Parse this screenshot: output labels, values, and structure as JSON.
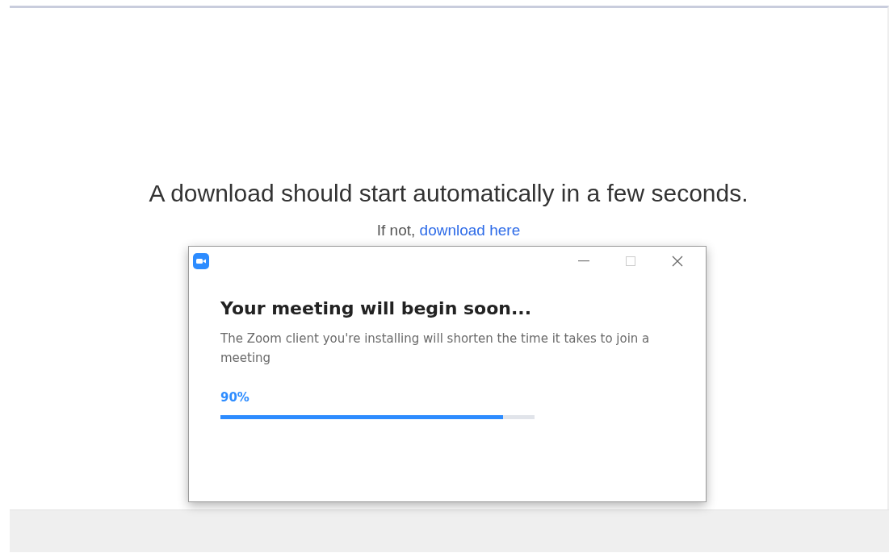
{
  "page": {
    "heading": "A download should start automatically in a few seconds.",
    "fallback_prefix": "If not,",
    "fallback_link": "download here"
  },
  "dialog": {
    "title": "Your meeting will begin soon...",
    "message": "The Zoom client you're installing will shorten the time it takes to join a meeting",
    "percent": "90%",
    "level": 0.9
  }
}
